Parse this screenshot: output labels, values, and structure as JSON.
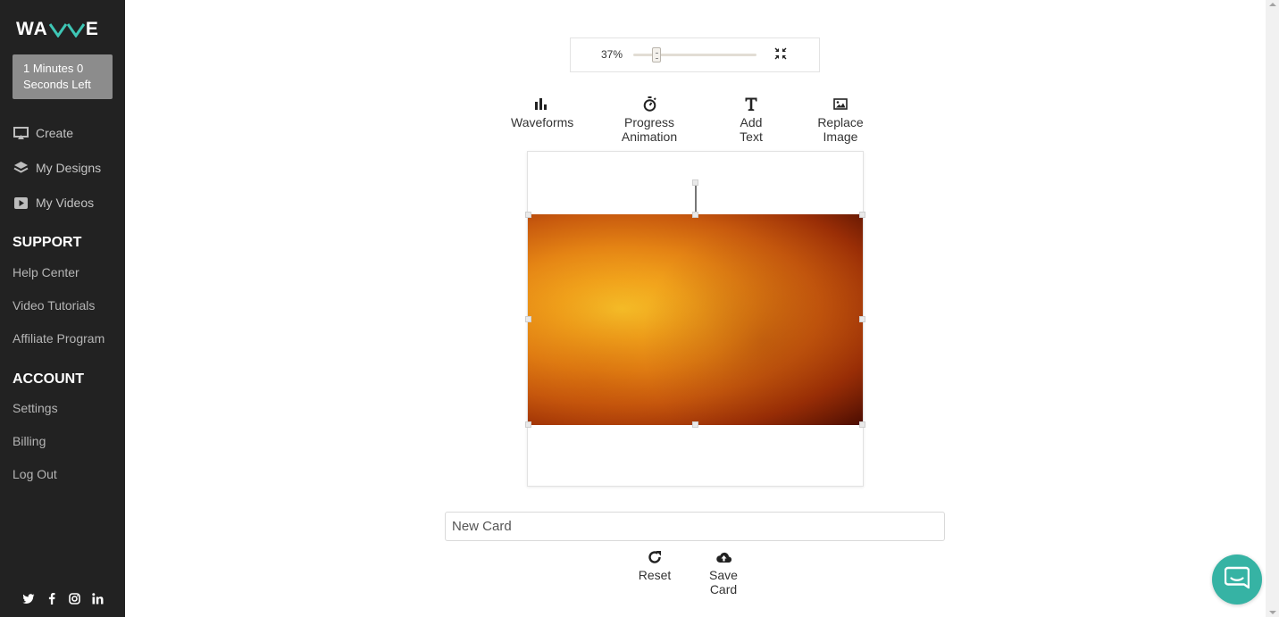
{
  "sidebar": {
    "logo_text_left": "WA",
    "logo_text_right": "E",
    "timer": "1 Minutes 0 Seconds Left",
    "nav": [
      {
        "label": "Create",
        "icon": "presentation-icon"
      },
      {
        "label": "My Designs",
        "icon": "layers-icon"
      },
      {
        "label": "My Videos",
        "icon": "play-icon"
      }
    ],
    "support_title": "SUPPORT",
    "support_links": [
      "Help Center",
      "Video Tutorials",
      "Affiliate Program"
    ],
    "account_title": "ACCOUNT",
    "account_links": [
      "Settings",
      "Billing",
      "Log Out"
    ],
    "social": [
      "twitter-icon",
      "facebook-icon",
      "instagram-icon",
      "linkedin-icon"
    ]
  },
  "zoom": {
    "label": "37%",
    "value_percent": 37
  },
  "toolbar": {
    "waveforms": "Waveforms",
    "progress_animation": "Progress Animation",
    "add_text": "Add Text",
    "replace_image": "Replace Image"
  },
  "card": {
    "name_value": "New Card"
  },
  "actions": {
    "reset": "Reset",
    "save_card": "Save Card"
  },
  "colors": {
    "sidebar_bg": "#222222",
    "accent_teal": "#36b3a4",
    "timer_bg": "#8c8c8c"
  }
}
